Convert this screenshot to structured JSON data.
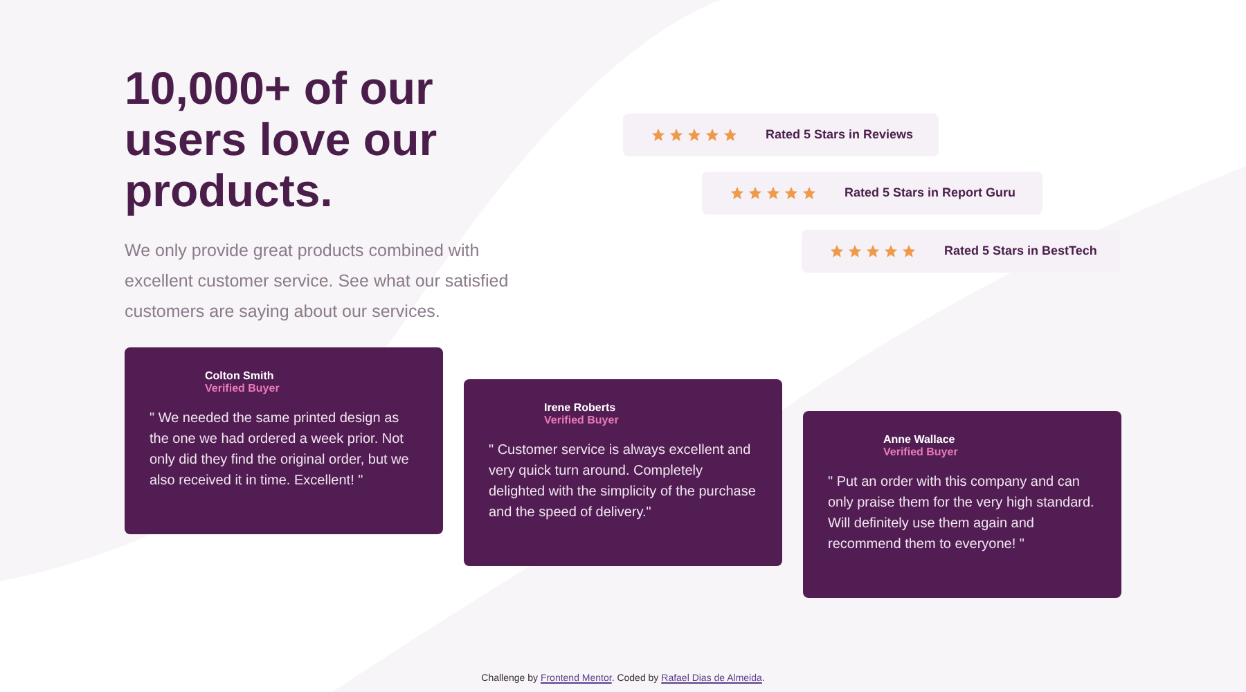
{
  "heading": "10,000+ of our users love our products.",
  "intro": "We only provide great products combined with excellent customer service. See what our satisfied customers are saying about our services.",
  "ratings": [
    {
      "stars": 5,
      "label": "Rated 5 Stars in Reviews"
    },
    {
      "stars": 5,
      "label": "Rated 5 Stars in Report Guru"
    },
    {
      "stars": 5,
      "label": "Rated 5 Stars in BestTech"
    }
  ],
  "testimonials": [
    {
      "name": "Colton Smith",
      "badge": "Verified Buyer",
      "quote": "\" We needed the same printed design as the one we had ordered a week prior. Not only did they find the original order, but we also received it in time. Excellent! \""
    },
    {
      "name": "Irene Roberts",
      "badge": "Verified Buyer",
      "quote": "\" Customer service is always excellent and very quick turn around. Completely delighted with the simplicity of the purchase and the speed of delivery.\""
    },
    {
      "name": "Anne Wallace",
      "badge": "Verified Buyer",
      "quote": "\" Put an order with this company and can only praise them for the very high standard. Will definitely use them again and recommend them to everyone! \""
    }
  ],
  "attribution": {
    "before": "Challenge by",
    "link_1": "Frontend Mentor",
    "between": ". Coded by",
    "link_2": "Rafael Dias de Almeida",
    "after": "."
  }
}
